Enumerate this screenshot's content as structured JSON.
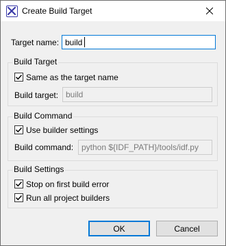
{
  "window": {
    "title": "Create Build Target",
    "app_icon": "eclipse-x-icon",
    "close_icon": "close-icon"
  },
  "target_name": {
    "label": "Target name:",
    "value": "build"
  },
  "build_target_group": {
    "title": "Build Target",
    "same_as_name_label": "Same as the target name",
    "same_as_name_checked": true,
    "build_target_label": "Build target:",
    "build_target_value": "build"
  },
  "build_command_group": {
    "title": "Build Command",
    "use_builder_label": "Use builder settings",
    "use_builder_checked": true,
    "build_command_label": "Build command:",
    "build_command_value": "python ${IDF_PATH}/tools/idf.py"
  },
  "build_settings_group": {
    "title": "Build Settings",
    "stop_on_error_label": "Stop on first build error",
    "stop_on_error_checked": true,
    "run_all_label": "Run all project builders",
    "run_all_checked": true
  },
  "buttons": {
    "ok": "OK",
    "cancel": "Cancel"
  }
}
